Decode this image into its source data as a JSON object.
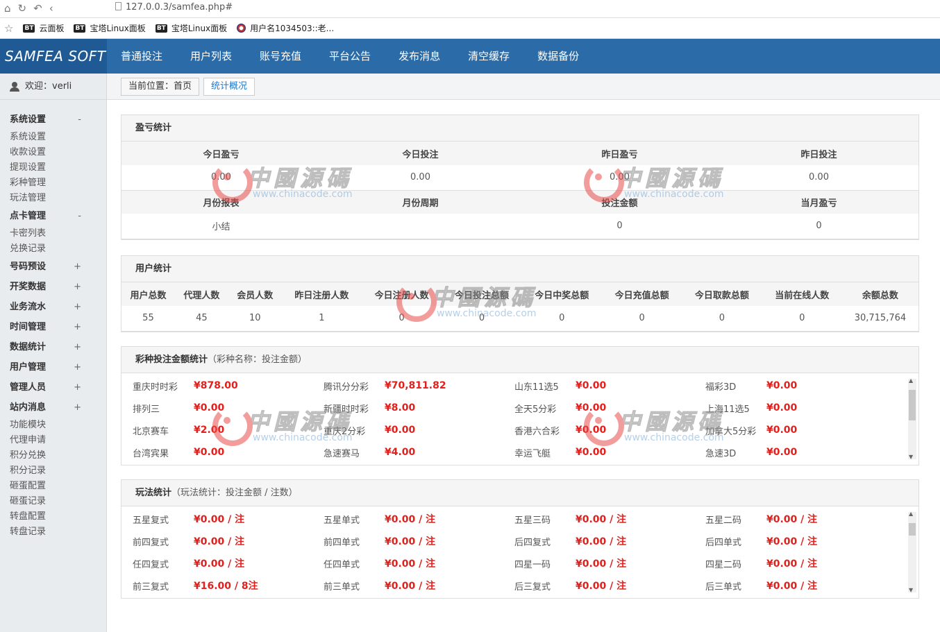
{
  "browser": {
    "url": "127.0.0.3/samfea.php#",
    "bookmarks": [
      {
        "badge": "BT",
        "label": "云面板"
      },
      {
        "badge": "BT",
        "label": "宝塔Linux面板"
      },
      {
        "badge": "BT",
        "label": "宝塔Linux面板"
      },
      {
        "badge": "",
        "label": "用户名1034503::老..."
      }
    ]
  },
  "header": {
    "brand": "SAMFEA SOFT",
    "nav": [
      "普通投注",
      "用户列表",
      "账号充值",
      "平台公告",
      "发布消息",
      "清空缓存",
      "数据备份"
    ]
  },
  "sidebar": {
    "welcome": "欢迎：verli",
    "groups": [
      {
        "title": "系统设置",
        "sign": "-",
        "items": [
          "系统设置",
          "收款设置",
          "提现设置",
          "彩种管理",
          "玩法管理"
        ]
      },
      {
        "title": "点卡管理",
        "sign": "-",
        "items": [
          "卡密列表",
          "兑换记录"
        ]
      },
      {
        "title": "号码预设",
        "sign": "+",
        "items": []
      },
      {
        "title": "开奖数据",
        "sign": "+",
        "items": []
      },
      {
        "title": "业务流水",
        "sign": "+",
        "items": []
      },
      {
        "title": "时间管理",
        "sign": "+",
        "items": []
      },
      {
        "title": "数据统计",
        "sign": "+",
        "items": []
      },
      {
        "title": "用户管理",
        "sign": "+",
        "items": []
      },
      {
        "title": "管理人员",
        "sign": "+",
        "items": []
      },
      {
        "title": "站内消息",
        "sign": "+",
        "items": [
          "功能模块",
          "代理申请",
          "积分兑换",
          "积分记录",
          "砸蛋配置",
          "砸蛋记录",
          "转盘配置",
          "转盘记录"
        ]
      }
    ]
  },
  "breadcrumb": {
    "current": "当前位置：首页",
    "active": "统计概况"
  },
  "profit": {
    "title": "盈亏统计",
    "headers1": [
      "今日盈亏",
      "今日投注",
      "昨日盈亏",
      "昨日投注"
    ],
    "values1": [
      "0.00",
      "0.00",
      "0.00",
      "0.00"
    ],
    "headers2": [
      "月份报表",
      "月份周期",
      "投注金额",
      "当月盈亏"
    ],
    "values2": [
      "小结",
      "",
      "0",
      "0"
    ]
  },
  "users": {
    "title": "用户统计",
    "headers": [
      "用户总数",
      "代理人数",
      "会员人数",
      "昨日注册人数",
      "今日注册人数",
      "今日投注总额",
      "今日中奖总额",
      "今日充值总额",
      "今日取款总额",
      "当前在线人数",
      "余额总数"
    ],
    "values": [
      "55",
      "45",
      "10",
      "1",
      "0",
      "0",
      "0",
      "0",
      "0",
      "0",
      "30,715,764"
    ]
  },
  "lottery": {
    "title": "彩种投注金额统计",
    "note": "（彩种名称：投注金额）",
    "items": [
      {
        "name": "重庆时时彩",
        "value": "¥878.00"
      },
      {
        "name": "腾讯分分彩",
        "value": "¥70,811.82"
      },
      {
        "name": "山东11选5",
        "value": "¥0.00"
      },
      {
        "name": "福彩3D",
        "value": "¥0.00"
      },
      {
        "name": "排列三",
        "value": "¥0.00"
      },
      {
        "name": "新疆时时彩",
        "value": "¥8.00"
      },
      {
        "name": "全天5分彩",
        "value": "¥0.00"
      },
      {
        "name": "上海11选5",
        "value": "¥0.00"
      },
      {
        "name": "北京赛车",
        "value": "¥2.00"
      },
      {
        "name": "重庆2分彩",
        "value": "¥0.00"
      },
      {
        "name": "香港六合彩",
        "value": "¥0.00"
      },
      {
        "name": "加拿大5分彩",
        "value": "¥0.00"
      },
      {
        "name": "台湾宾果",
        "value": "¥0.00"
      },
      {
        "name": "急速赛马",
        "value": "¥4.00"
      },
      {
        "name": "幸运飞艇",
        "value": "¥0.00"
      },
      {
        "name": "急速3D",
        "value": "¥0.00"
      }
    ]
  },
  "plays": {
    "title": "玩法统计",
    "note": "（玩法统计：投注金额 / 注数）",
    "items": [
      {
        "name": "五星复式",
        "value": "¥0.00 / 注"
      },
      {
        "name": "五星单式",
        "value": "¥0.00 / 注"
      },
      {
        "name": "五星三码",
        "value": "¥0.00 / 注"
      },
      {
        "name": "五星二码",
        "value": "¥0.00 / 注"
      },
      {
        "name": "前四复式",
        "value": "¥0.00 / 注"
      },
      {
        "name": "前四单式",
        "value": "¥0.00 / 注"
      },
      {
        "name": "后四复式",
        "value": "¥0.00 / 注"
      },
      {
        "name": "后四单式",
        "value": "¥0.00 / 注"
      },
      {
        "name": "任四复式",
        "value": "¥0.00 / 注"
      },
      {
        "name": "任四单式",
        "value": "¥0.00 / 注"
      },
      {
        "name": "四星一码",
        "value": "¥0.00 / 注"
      },
      {
        "name": "四星二码",
        "value": "¥0.00 / 注"
      },
      {
        "name": "前三复式",
        "value": "¥16.00 / 8注"
      },
      {
        "name": "前三单式",
        "value": "¥0.00 / 注"
      },
      {
        "name": "后三复式",
        "value": "¥0.00 / 注"
      },
      {
        "name": "后三单式",
        "value": "¥0.00 / 注"
      }
    ]
  },
  "watermark": {
    "cn": "中國源碼",
    "en": "www.chinacode.com"
  },
  "colors": {
    "header": "#2b6ca8",
    "brand_bg": "#1f5a95",
    "money": "#e0201c",
    "active_crumb": "#1f78c8"
  }
}
